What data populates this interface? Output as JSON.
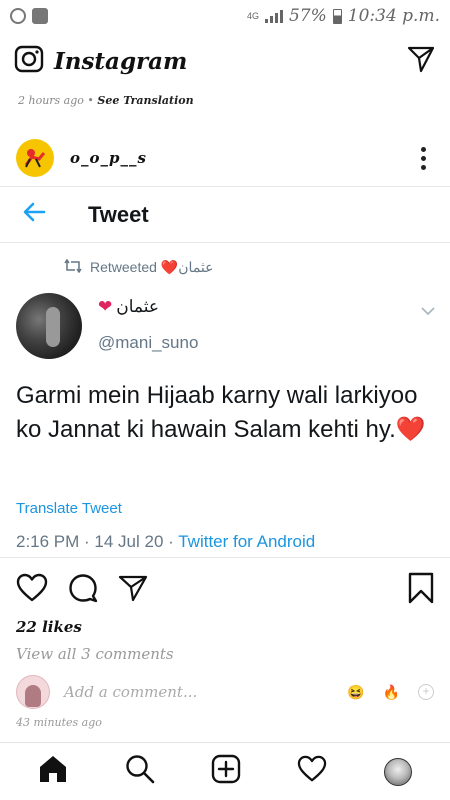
{
  "status_bar": {
    "network": "4G",
    "battery": "57%",
    "time": "10:34 p.m.",
    "battery_level": 0.57
  },
  "header": {
    "app_title": "Instagram",
    "camera_icon": "camera-icon",
    "direct_icon": "paper-plane-icon"
  },
  "post_meta": {
    "time": "2 hours ago",
    "separator": "•",
    "translation_link": "See Translation"
  },
  "post_user": {
    "username": "o_o_p__s"
  },
  "tweet": {
    "header_title": "Tweet",
    "retweeted_by": "Retweeted ❤️عثمان",
    "author_name": "عثمان",
    "author_handle": "@mani_suno",
    "text": "Garmi mein Hijaab karny wali larkiyoo ko Jannat ki hawain Salam kehti hy.",
    "text_emoji": "❤️",
    "translate_link": "Translate Tweet",
    "timestamp": "2:16 PM · 14 Jul 20 · ",
    "source": "Twitter for Android",
    "accent_color": "#1b95e0"
  },
  "engagement": {
    "likes": "22 likes",
    "view_comments": "View all 3 comments",
    "comment_placeholder": "Add a comment...",
    "quick_emojis": [
      "😆",
      "🔥"
    ],
    "posted_ago": "43 minutes ago"
  },
  "bottom_nav": [
    "home-icon",
    "search-icon",
    "new-post-icon",
    "activity-heart-icon",
    "profile-avatar"
  ]
}
